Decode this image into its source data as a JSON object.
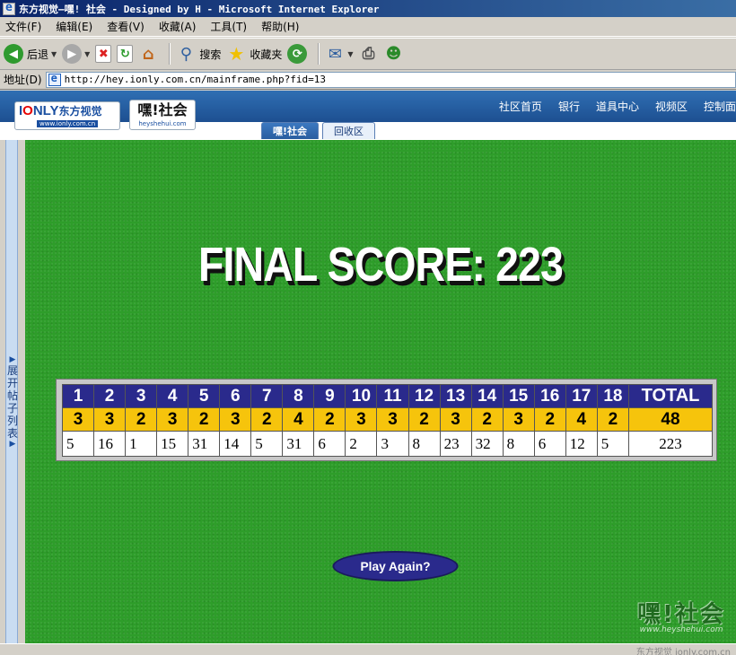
{
  "window": {
    "title": "东方视觉—嘿! 社会 - Designed by H - Microsoft Internet Explorer"
  },
  "menu": [
    "文件(F)",
    "编辑(E)",
    "查看(V)",
    "收藏(A)",
    "工具(T)",
    "帮助(H)"
  ],
  "toolbar": {
    "back": "后退",
    "search": "搜索",
    "favorites": "收藏夹"
  },
  "address": {
    "label": "地址(D)",
    "url": "http://hey.ionly.com.cn/mainframe.php?fid=13"
  },
  "site": {
    "logo_ionly": "IONLY东方视觉",
    "logo_ionly_url": "www.ionly.com.cn",
    "logo_heys": "嘿!社会",
    "logo_heys_url": "heyshehui.com",
    "nav": [
      "社区首页",
      "银行",
      "道具中心",
      "视频区",
      "控制面"
    ],
    "tabs": [
      "嘿!社会",
      "回收区"
    ]
  },
  "sidebar": {
    "toggle_label": "展开帖子列表"
  },
  "game": {
    "final_score": "FINAL SCORE: 223",
    "total_label": "TOTAL",
    "holes": [
      "1",
      "2",
      "3",
      "4",
      "5",
      "6",
      "7",
      "8",
      "9",
      "10",
      "11",
      "12",
      "13",
      "14",
      "15",
      "16",
      "17",
      "18"
    ],
    "pars": [
      "3",
      "3",
      "2",
      "3",
      "2",
      "3",
      "2",
      "4",
      "2",
      "3",
      "3",
      "2",
      "3",
      "2",
      "3",
      "2",
      "4",
      "2"
    ],
    "par_total": "48",
    "strokes": [
      "5",
      "16",
      "1",
      "15",
      "31",
      "14",
      "5",
      "31",
      "6",
      "2",
      "3",
      "8",
      "23",
      "32",
      "8",
      "6",
      "12",
      "5"
    ],
    "stroke_total": "223",
    "play_again": "Play Again?",
    "watermark": "嘿!社会",
    "watermark_url": "www.heyshehui.com"
  },
  "status": {
    "text": "东方视觉 ionly.com.cn"
  }
}
